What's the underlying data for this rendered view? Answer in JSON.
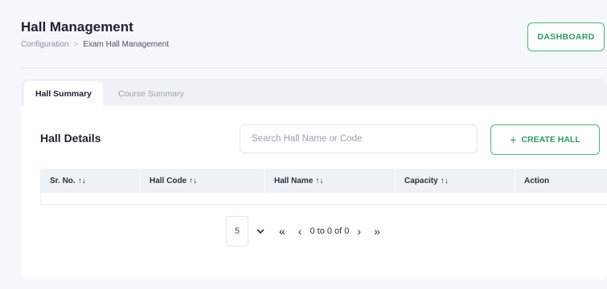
{
  "header": {
    "title": "Hall Management",
    "breadcrumb": [
      "Configuration",
      "Exam Hall Management"
    ],
    "breadcrumb_separator": ">",
    "dashboard_button": "DASHBOARD"
  },
  "tabs": [
    {
      "label": "Hall Summary",
      "active": true
    },
    {
      "label": "Course Summary",
      "active": false
    }
  ],
  "section": {
    "title": "Hall Details",
    "search_placeholder": "Search Hall Name or Code",
    "create_button": "CREATE HALL",
    "create_icon": "+"
  },
  "table": {
    "columns": [
      "Sr. No.",
      "Hall Code",
      "Hall Name",
      "Capacity",
      "Action"
    ],
    "sort_icon": "↑↓",
    "rows": []
  },
  "pagination": {
    "page_size": "5",
    "dropdown_icon": "chevron-down-icon",
    "first_icon": "«",
    "prev_icon": "‹",
    "status": "0 to 0 of 0",
    "next_icon": "›",
    "last_icon": "»"
  },
  "colors": {
    "accent_green": "#47b873",
    "accent_green_text": "#2f9b5e",
    "background": "#f5f7fb",
    "table_header_bg": "#eef1f5"
  }
}
